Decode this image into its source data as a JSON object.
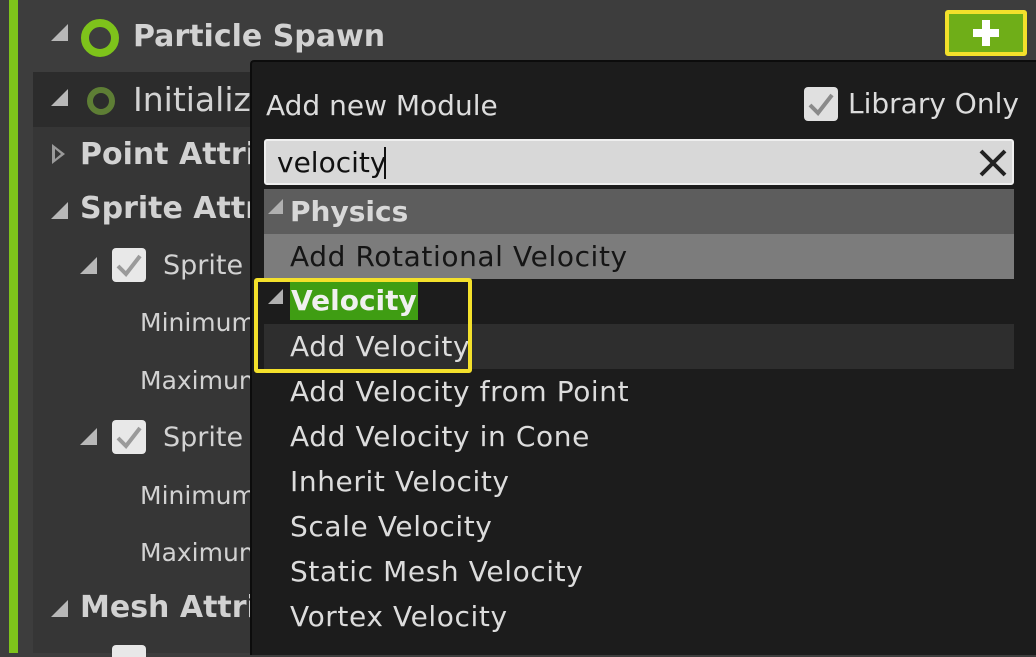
{
  "panel": {
    "particle_spawn": "Particle Spawn",
    "initialize": "Initializ",
    "point_attrib": "Point Attrib",
    "sprite_attrib": "Sprite Attrib",
    "sprite_s": "Sprite S",
    "minimum_1": "Minimum",
    "maximum_1": "Maximum",
    "sprite_r": "Sprite R",
    "minimum_2": "Minimum",
    "maximum_2": "Maximum",
    "mesh_attrib": "Mesh Attrib",
    "add_button_label": "+"
  },
  "popup": {
    "title": "Add new Module",
    "library_only_label": "Library Only",
    "library_only_checked": true,
    "search": {
      "value": "velocity",
      "placeholder": ""
    },
    "categories": [
      {
        "name": "Physics",
        "items": [
          "Add Rotational Velocity"
        ]
      },
      {
        "name": "Velocity",
        "items": [
          "Add Velocity",
          "Add Velocity from Point",
          "Add Velocity in Cone",
          "Inherit Velocity",
          "Scale Velocity",
          "Static Mesh Velocity",
          "Vortex Velocity"
        ]
      }
    ]
  },
  "colors": {
    "accent_green": "#7ec31b",
    "highlight_yellow": "#f3e02b",
    "category_highlight": "#3f9d13",
    "selected_row": "#7c7c7c"
  },
  "icons": {
    "expand": "triangle-down-icon",
    "collapsed": "triangle-right-icon",
    "module_status": "ring-icon",
    "checkbox": "checkmark-icon",
    "clear": "close-icon",
    "add": "plus-icon"
  }
}
